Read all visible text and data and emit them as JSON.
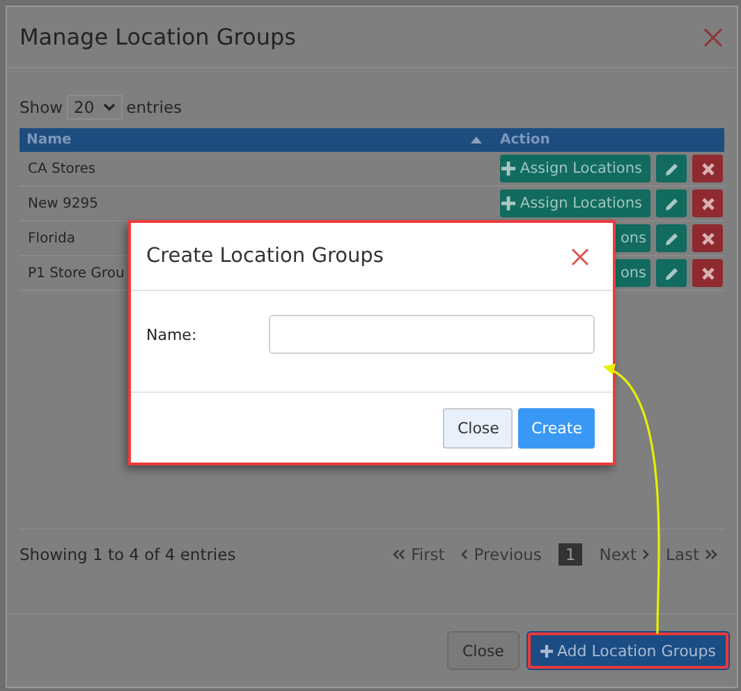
{
  "window": {
    "title": "Manage Location Groups"
  },
  "length": {
    "prefix": "Show",
    "value": "20",
    "suffix": "entries"
  },
  "table": {
    "columns": [
      {
        "label": "Name",
        "sorted": true
      },
      {
        "label": "Action"
      }
    ],
    "rows": [
      {
        "name": "CA Stores",
        "assign": "Assign Locations",
        "assign_icon": true
      },
      {
        "name": "New 9295",
        "assign": "Assign Locations",
        "assign_icon": true
      },
      {
        "name": "Florida",
        "assign": "ons",
        "assign_icon": false
      },
      {
        "name": "P1 Store Grou",
        "assign": "ons",
        "assign_icon": false
      }
    ]
  },
  "info": "Showing 1 to 4 of 4 entries",
  "pagination": [
    {
      "label": "First",
      "kind": "first",
      "selected": false
    },
    {
      "label": "Previous",
      "kind": "prev",
      "selected": false
    },
    {
      "label": "1",
      "kind": "page",
      "selected": true
    },
    {
      "label": "Next",
      "kind": "next",
      "selected": false
    },
    {
      "label": "Last",
      "kind": "last",
      "selected": false
    }
  ],
  "buttons": [
    {
      "label": "Close",
      "kind": "default",
      "highlighted": false
    },
    {
      "label": "Add Location Groups",
      "kind": "primary",
      "highlighted": true
    }
  ],
  "modal": {
    "title": "Create Location Groups",
    "highlighted": true,
    "fields": [
      {
        "label": "Name:"
      }
    ],
    "buttons": [
      {
        "label": "Close",
        "kind": "default"
      },
      {
        "label": "Create",
        "kind": "primary"
      }
    ]
  }
}
